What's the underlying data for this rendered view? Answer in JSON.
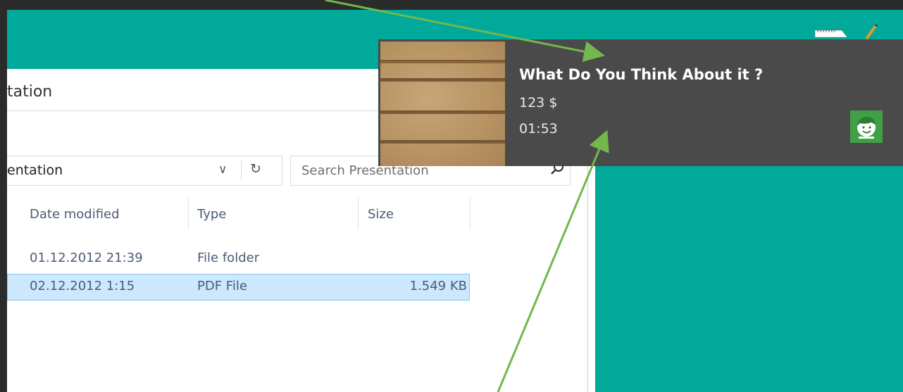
{
  "explorer": {
    "title": "tation",
    "address": "entation",
    "search_placeholder": "Search Presentation",
    "columns": [
      "Date modified",
      "Type",
      "Size"
    ],
    "rows": [
      {
        "date": "01.12.2012 21:39",
        "type": "File folder",
        "size": ""
      },
      {
        "date": "02.12.2012 1:15",
        "type": "PDF File",
        "size": "1.549 KB"
      }
    ]
  },
  "toast": {
    "title": "What Do You Think About it ?",
    "line2": "123 $",
    "line3": "01:53",
    "image_icon": "shelf-photo",
    "app_icon": "smiley-face-icon",
    "app_color": "#3fa047"
  },
  "colors": {
    "desktop": "#00a99a",
    "toast_bg": "#4a4a4a",
    "selected_row": "#cce8ff",
    "arrow": "#72b84c"
  },
  "taskbar_icons": [
    "ruler-icon",
    "pencil-icon"
  ]
}
